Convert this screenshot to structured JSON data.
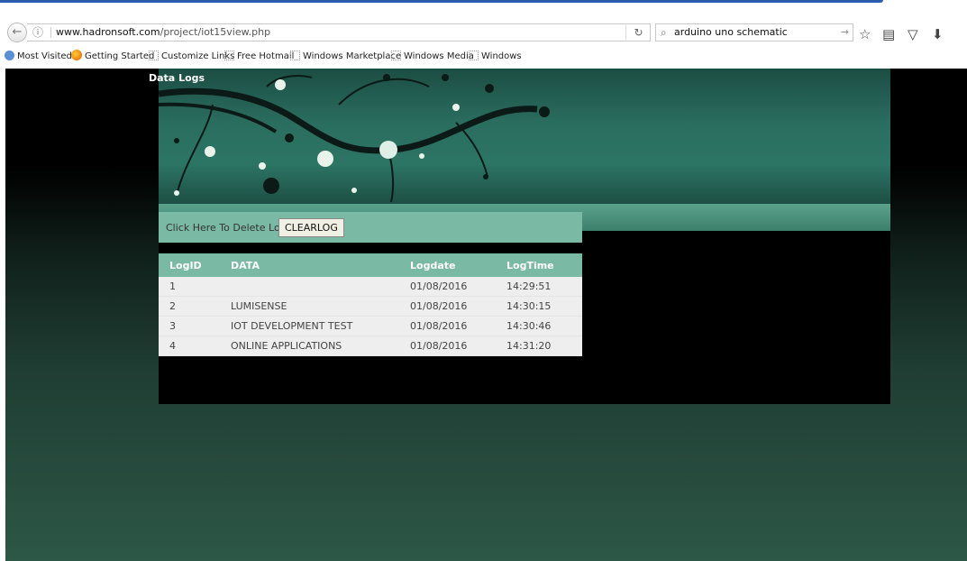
{
  "browser": {
    "url_host": "www.hadronsoft.com",
    "url_path": "/project/iot15view.php",
    "search_text": "arduino uno schematic",
    "bookmarks": [
      {
        "label": "Most Visited",
        "icon": "globe-icon"
      },
      {
        "label": "Getting Started",
        "icon": "firefox-icon"
      },
      {
        "label": "Customize Links",
        "icon": "bookmark-icon"
      },
      {
        "label": "Free Hotmail",
        "icon": "bookmark-icon"
      },
      {
        "label": "Windows Marketplace",
        "icon": "bookmark-icon"
      },
      {
        "label": "Windows Media",
        "icon": "bookmark-icon"
      },
      {
        "label": "Windows",
        "icon": "bookmark-icon"
      }
    ]
  },
  "page": {
    "title": "Data Logs",
    "clear_label": "Click Here To Delete Logs",
    "clear_button": "CLEARLOG",
    "columns": [
      "LogID",
      "DATA",
      "Logdate",
      "LogTime"
    ],
    "rows": [
      [
        "1",
        "",
        "01/08/2016",
        "14:29:51"
      ],
      [
        "2",
        "LUMISENSE",
        "01/08/2016",
        "14:30:15"
      ],
      [
        "3",
        "IOT DEVELOPMENT TEST",
        "01/08/2016",
        "14:30:46"
      ],
      [
        "4",
        "ONLINE APPLICATIONS",
        "01/08/2016",
        "14:31:20"
      ]
    ]
  },
  "colors": {
    "accent": "#7ab9a3",
    "banner": "#2a6d5f",
    "row_bg": "#eeeeee"
  }
}
